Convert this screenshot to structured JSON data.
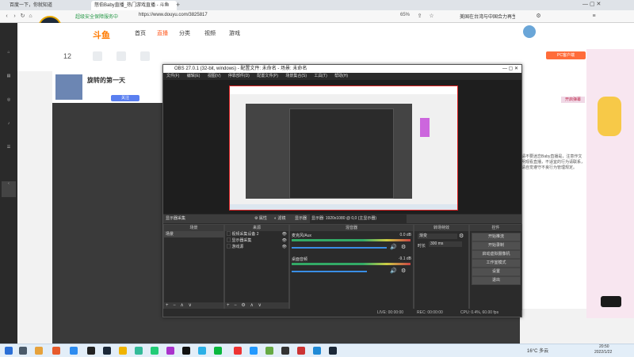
{
  "browser": {
    "tabs": [
      {
        "label": "百度一下，你就知道"
      },
      {
        "label": "怒伯Baby直播_热门游戏直播 - 斗鱼"
      }
    ],
    "new_tab_symbol": "+",
    "fps_badge": "58",
    "fps_badge_sub": "FPS",
    "security_label": "超级安全保障服务中",
    "url": "https://www.douyu.com/3825817",
    "zoom": "65%",
    "search_hint": "美国在台湾与中国合力再生人"
  },
  "douyu": {
    "logo": "斗鱼",
    "nav": [
      "首页",
      "直播",
      "分类",
      "视频",
      "游戏"
    ],
    "room_title": "旋转的第一天",
    "rank_label": "12",
    "follow_button": "关注",
    "right_banner": "PC客户端",
    "right_label": "开启弹幕",
    "side_text": "请不要迷恋Baby直播是，注意作文明观看直播，不适宜的行为请联系，请自觉遵守不良行为管理规定。"
  },
  "obs": {
    "title": "OBS 27.0.1 (32-bit, windows) - 配置文件: 未命名 - 场景: 未命名",
    "menu": [
      "文件(F)",
      "编辑(E)",
      "视图(V)",
      "停靠部件(D)",
      "配置文件(P)",
      "场景集合(S)",
      "工具(T)",
      "帮助(H)"
    ],
    "source_bar": {
      "label": "显示器采集",
      "properties": "属性",
      "filters": "滤镜",
      "display_label": "显示器",
      "display_value": "显示器: 1920x1080 @ 0,0 (主显示器)"
    },
    "scenes": {
      "header": "场景",
      "items": [
        "场景"
      ]
    },
    "sources": {
      "header": "来源",
      "items": [
        "视频采集设备 2",
        "显示器采集",
        "游戏源"
      ]
    },
    "mixer": {
      "header": "混音器",
      "channels": [
        {
          "name": "麦克风/Aux",
          "db": "0.0 dB"
        },
        {
          "name": "桌面音频",
          "db": "-9.1 dB"
        }
      ]
    },
    "transitions": {
      "header": "转场特效",
      "type": "渐变",
      "duration_label": "时长",
      "duration": "300 ms"
    },
    "controls": {
      "header": "控件",
      "buttons": [
        "开始推流",
        "开始录制",
        "启动虚拟摄像机",
        "工作室模式",
        "设置",
        "退出"
      ]
    },
    "status": {
      "live": "LIVE: 00:00:00",
      "rec": "REC: 00:00:00",
      "cpu": "CPU: 0.4%, 60.00 fps"
    }
  },
  "taskbar": {
    "weather": "16°C 多云",
    "time": "20:50",
    "date": "2022/1/22"
  }
}
